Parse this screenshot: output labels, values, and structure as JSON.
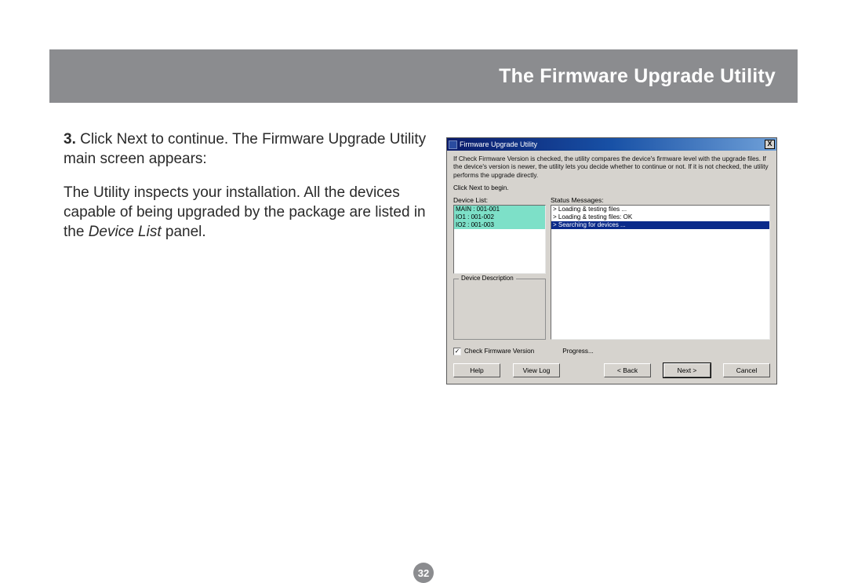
{
  "header": {
    "title": "The Firmware Upgrade Utility"
  },
  "body": {
    "step_num": "3.",
    "step_line": " Click Next to continue. The Firmware Upgrade Utility main screen appears:",
    "para2_a": "The Utility inspects your installation. All the devices capable of being upgraded by the package are listed in the ",
    "para2_em": "Device List",
    "para2_b": " panel."
  },
  "window": {
    "title": "Firmware Upgrade Utility",
    "close": "X",
    "instruction": "If Check Firmware Version is checked, the utility compares the device's firmware level with the upgrade files. If the device's version is newer, the utility lets you decide whether to continue or not. If it is not checked, the utility performs the upgrade directly.",
    "instruction2": "Click Next to begin.",
    "device_label": "Device List:",
    "status_label": "Status Messages:",
    "devices": [
      "MAIN : 001-001",
      "IO1 : 001-002",
      "IO2 : 001-003"
    ],
    "messages": [
      "> Loading & testing files ...",
      "> Loading & testing files: OK",
      "> Searching for devices ..."
    ],
    "desc_legend": "Device Description",
    "check_label": "Check Firmware Version",
    "progress_label": "Progress...",
    "buttons": {
      "help": "Help",
      "viewlog": "View Log",
      "back": "< Back",
      "next": "Next >",
      "cancel": "Cancel"
    }
  },
  "page_number": "32"
}
